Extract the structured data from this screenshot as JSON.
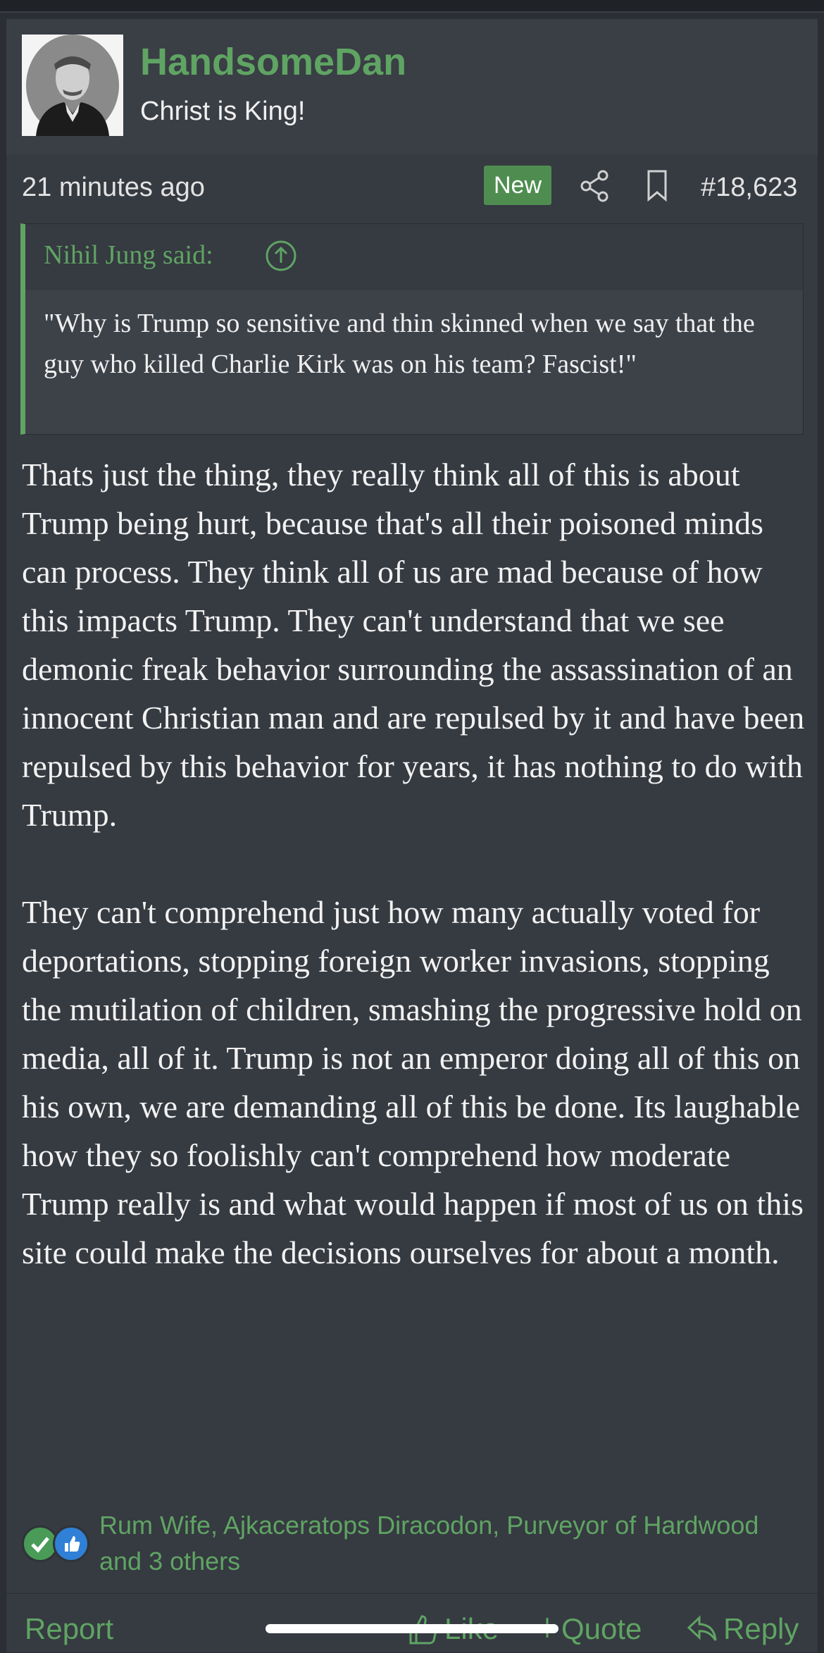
{
  "post": {
    "username": "HandsomeDan",
    "user_title": "Christ is King!",
    "timestamp": "21 minutes ago",
    "new_badge": "New",
    "post_number": "#18,623",
    "quote": {
      "author": "Nihil Jung said:",
      "text": "\"Why is Trump so sensitive and thin skinned when we say that the guy who killed Charlie Kirk was on his team? Fascist!\""
    },
    "paragraphs": [
      "Thats just the thing, they really think all of this is about Trump being hurt, because that's all their poisoned minds can process. They think all of us are mad because of how this impacts Trump. They can't understand that we see demonic freak behavior surrounding the assassination of an innocent Christian man and are repulsed by it and have been repulsed by this behavior for years, it has nothing to do with Trump.",
      "They can't comprehend just how many actually voted for deportations, stopping foreign worker invasions, stopping the mutilation of children, smashing the progressive hold on media, all of it. Trump is not an emperor doing all of this on his own, we are demanding all of this be done. Its laughable how they so foolishly can't comprehend how moderate Trump really is and what would happen if most of us on this site could make the decisions ourselves for about a month."
    ],
    "reactions_text": "Rum Wife, Ajkaceratops Diracodon, Purveyor of Hardwood and 3 others"
  },
  "footer": {
    "report": "Report",
    "like": "Like",
    "quote": "Quote",
    "reply": "Reply"
  },
  "colors": {
    "accent": "#5fa463",
    "background": "#363a41",
    "header": "#3a3e45",
    "badge": "#4e8d4f"
  },
  "icons": [
    "share-icon",
    "bookmark-icon",
    "arrow-up-circle-icon",
    "check-reaction-icon",
    "like-reaction-icon",
    "thumbs-up-icon",
    "plus-icon",
    "reply-icon"
  ]
}
